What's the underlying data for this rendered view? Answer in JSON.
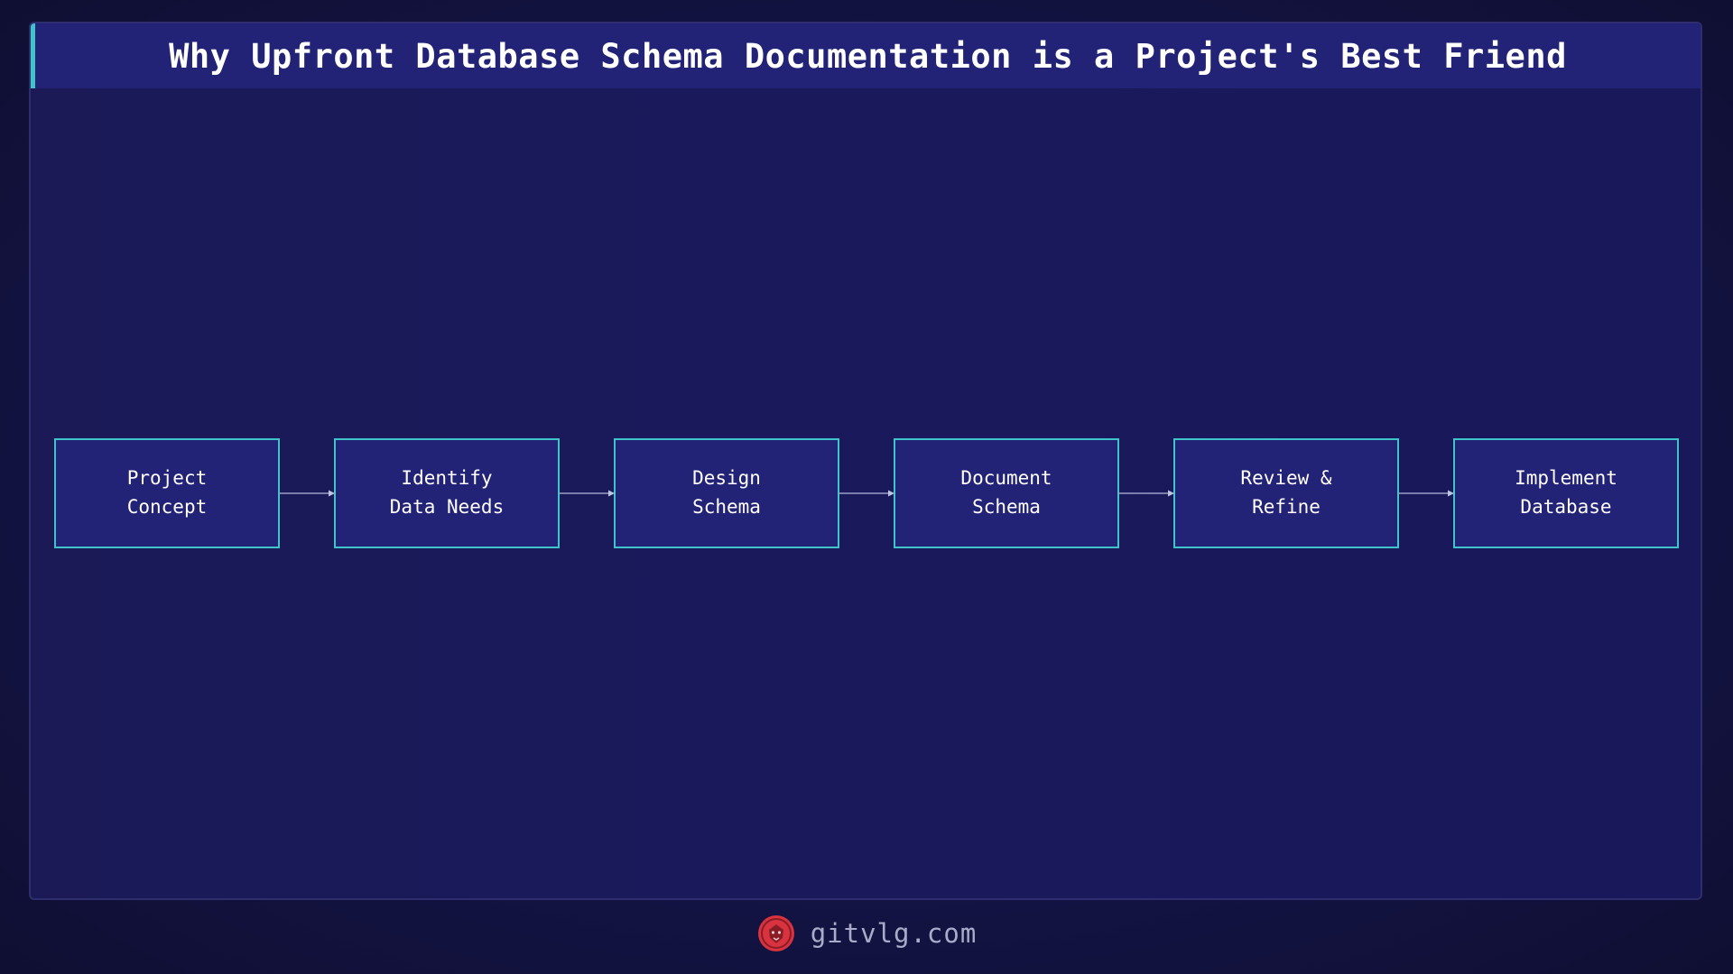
{
  "header": {
    "title": "Why Upfront Database Schema Documentation is a Project's Best Friend"
  },
  "diagram": {
    "nodes": [
      {
        "id": "n1",
        "lines": [
          "Project",
          "Concept"
        ]
      },
      {
        "id": "n2",
        "lines": [
          "Identify",
          "Data Needs"
        ]
      },
      {
        "id": "n3",
        "lines": [
          "Design",
          "Schema"
        ]
      },
      {
        "id": "n4",
        "lines": [
          "Document",
          "Schema"
        ]
      },
      {
        "id": "n5",
        "lines": [
          "Review &",
          "Refine"
        ]
      },
      {
        "id": "n6",
        "lines": [
          "Implement",
          "Database"
        ]
      }
    ],
    "edges": [
      {
        "from": "n1",
        "to": "n2"
      },
      {
        "from": "n2",
        "to": "n3"
      },
      {
        "from": "n3",
        "to": "n4"
      },
      {
        "from": "n4",
        "to": "n5"
      },
      {
        "from": "n5",
        "to": "n6"
      }
    ]
  },
  "footer": {
    "site": "gitvlg.com",
    "logo_icon": "lion-head-icon"
  },
  "colors": {
    "background": "#141446",
    "panel": "#1b1a57",
    "node_fill": "#222277",
    "node_border": "#3fc4c9",
    "accent": "#3fc4c9",
    "logo": "#d8333f"
  }
}
